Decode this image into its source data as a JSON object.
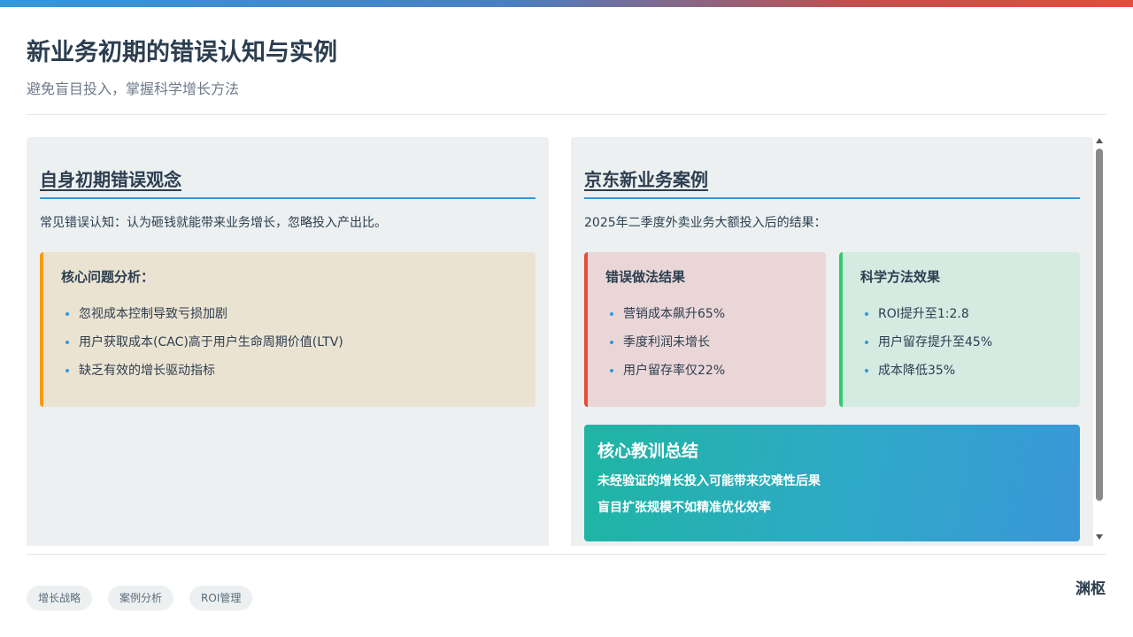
{
  "header": {
    "title": "新业务初期的错误认知与实例",
    "subtitle": "避免盲目投入，掌握科学增长方法"
  },
  "left_card": {
    "title": "自身初期错误观念",
    "intro": "常见错误认知：认为砸钱就能带来业务增长，忽略投入产出比。",
    "analysis": {
      "title": "核心问题分析：",
      "items": [
        "忽视成本控制导致亏损加剧",
        "用户获取成本(CAC)高于用户生命周期价值(LTV)",
        "缺乏有效的增长驱动指标"
      ]
    }
  },
  "right_card": {
    "title": "京东新业务案例",
    "intro": "2025年二季度外卖业务大额投入后的结果：",
    "wrong": {
      "title": "错误做法结果",
      "items": [
        "营销成本飙升65%",
        "季度利润未增长",
        "用户留存率仅22%"
      ]
    },
    "science": {
      "title": "科学方法效果",
      "items": [
        "ROI提升至1:2.8",
        "用户留存提升至45%",
        "成本降低35%"
      ]
    },
    "summary": {
      "title": "核心教训总结",
      "lines": [
        "未经验证的增长投入可能带来灾难性后果",
        "盲目扩张规模不如精准优化效率"
      ]
    }
  },
  "footer": {
    "tags": [
      "增长战略",
      "案例分析",
      "ROI管理"
    ],
    "brand": "渊枢"
  },
  "colors": {
    "accent_blue": "#3498db",
    "warning_orange": "#f39c12",
    "error_red": "#e74c3c",
    "success_green": "#2ecc71"
  },
  "icons": [
    "bullet-dot-icon",
    "scroll-up-arrow-icon",
    "scroll-down-arrow-icon"
  ]
}
